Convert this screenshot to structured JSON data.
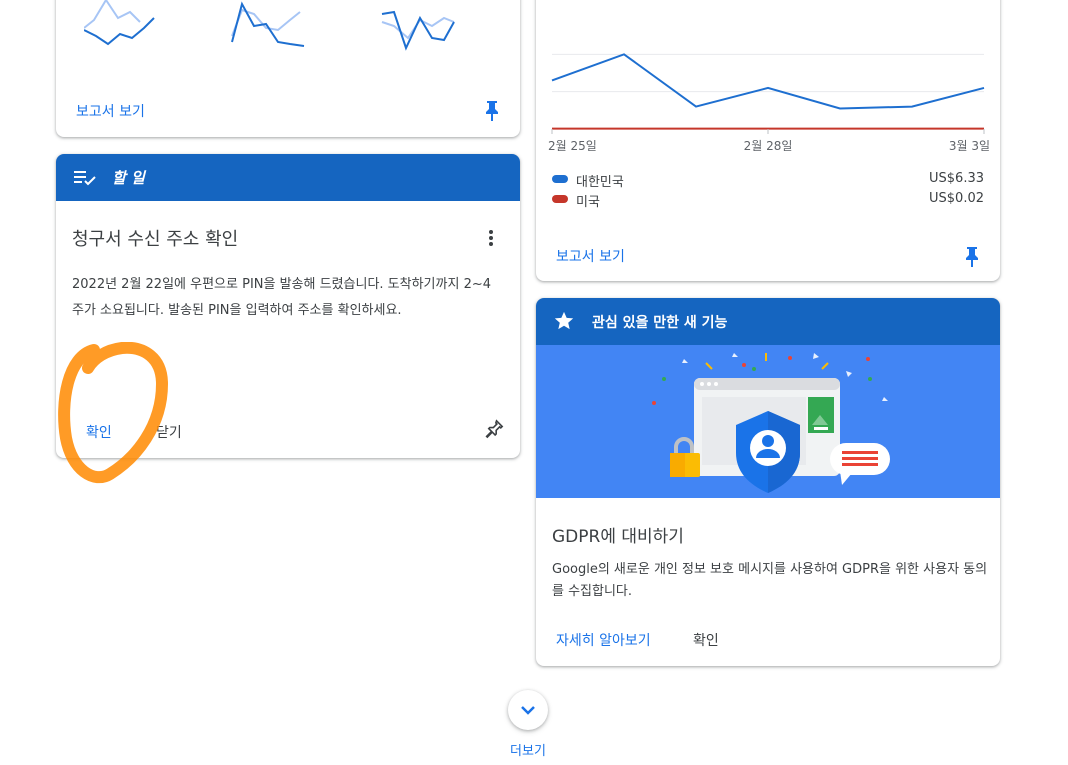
{
  "colors": {
    "header_blue": "#1565c0",
    "link_blue": "#1a73e8",
    "series_korea": "#1e6fd0",
    "series_usa": "#c5362a",
    "annotation": "#ff8a00"
  },
  "report_card": {
    "view_report": "보고서 보기",
    "pin_icon": "pin-icon"
  },
  "todo_card": {
    "header_icon": "checklist-icon",
    "header_title": "할 일",
    "heading": "청구서 수신 주소 확인",
    "body": "2022년 2월 22일에 우편으로 PIN을 발송해 드렸습니다. 도착하기까지 2~4주가 소요됩니다. 발송된 PIN을 입력하여 주소를 확인하세요.",
    "confirm_label": "확인",
    "close_label": "닫기",
    "more_icon": "more-vert-icon",
    "pin_icon": "pin-outline-icon"
  },
  "earnings_card": {
    "view_report": "보고서 보기",
    "legend": [
      {
        "label": "대한민국",
        "value": "US$6.33",
        "color": "#1e6fd0"
      },
      {
        "label": "미국",
        "value": "US$0.02",
        "color": "#c5362a"
      }
    ]
  },
  "chart_data": {
    "type": "line",
    "x": [
      "2월 25일",
      "2월 26일",
      "2월 27일",
      "2월 28일",
      "3월 1일",
      "3월 2일",
      "3월 3일"
    ],
    "x_tick_labels": [
      "2월 25일",
      "2월 28일",
      "3월 3일"
    ],
    "series": [
      {
        "name": "대한민국",
        "values": [
          1.3,
          2.0,
          0.6,
          1.1,
          0.55,
          0.6,
          1.1
        ],
        "color": "#1e6fd0"
      },
      {
        "name": "미국",
        "values": [
          0.01,
          0.01,
          0.01,
          0.01,
          0.01,
          0.01,
          0.01
        ],
        "color": "#c5362a"
      }
    ],
    "ylim": [
      0,
      3
    ],
    "grid": true
  },
  "feature_card": {
    "header_icon": "star-icon",
    "header_title": "관심 있을 만한 새 기능",
    "illustration": "privacy-shield-illustration",
    "heading": "GDPR에 대비하기",
    "body": "Google의 새로운 개인 정보 보호 메시지를 사용하여 GDPR을 위한 사용자 동의를 수집합니다.",
    "learn_more": "자세히 알아보기",
    "confirm_label": "확인"
  },
  "more": {
    "label": "더보기",
    "icon": "chevron-down-icon"
  }
}
